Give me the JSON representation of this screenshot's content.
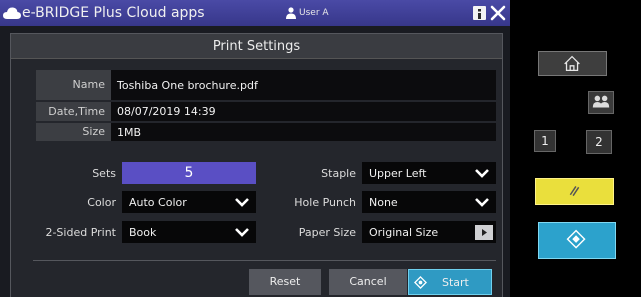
{
  "app": {
    "title": "e-BRIDGE Plus Cloud apps",
    "user": "User A",
    "accent": "#3f3f98"
  },
  "dialog": {
    "title": "Print Settings"
  },
  "file_info": {
    "name_label": "Name",
    "name_value": "Toshiba One brochure.pdf",
    "date_label": "Date,Time",
    "date_value": "08/07/2019 14:39",
    "size_label": "Size",
    "size_value": "1MB"
  },
  "settings": {
    "sets_label": "Sets",
    "sets_value": "5",
    "color_label": "Color",
    "color_value": "Auto Color",
    "sided_label": "2-Sided Print",
    "sided_value": "Book",
    "staple_label": "Staple",
    "staple_value": "Upper Left",
    "hole_label": "Hole Punch",
    "hole_value": "None",
    "paper_label": "Paper Size",
    "paper_value": "Original Size"
  },
  "actions": {
    "reset": "Reset",
    "cancel": "Cancel",
    "start": "Start"
  },
  "panel": {
    "one": "1",
    "two": "2",
    "stop_color": "#eadf3c",
    "start_color": "#2ca2cc"
  }
}
